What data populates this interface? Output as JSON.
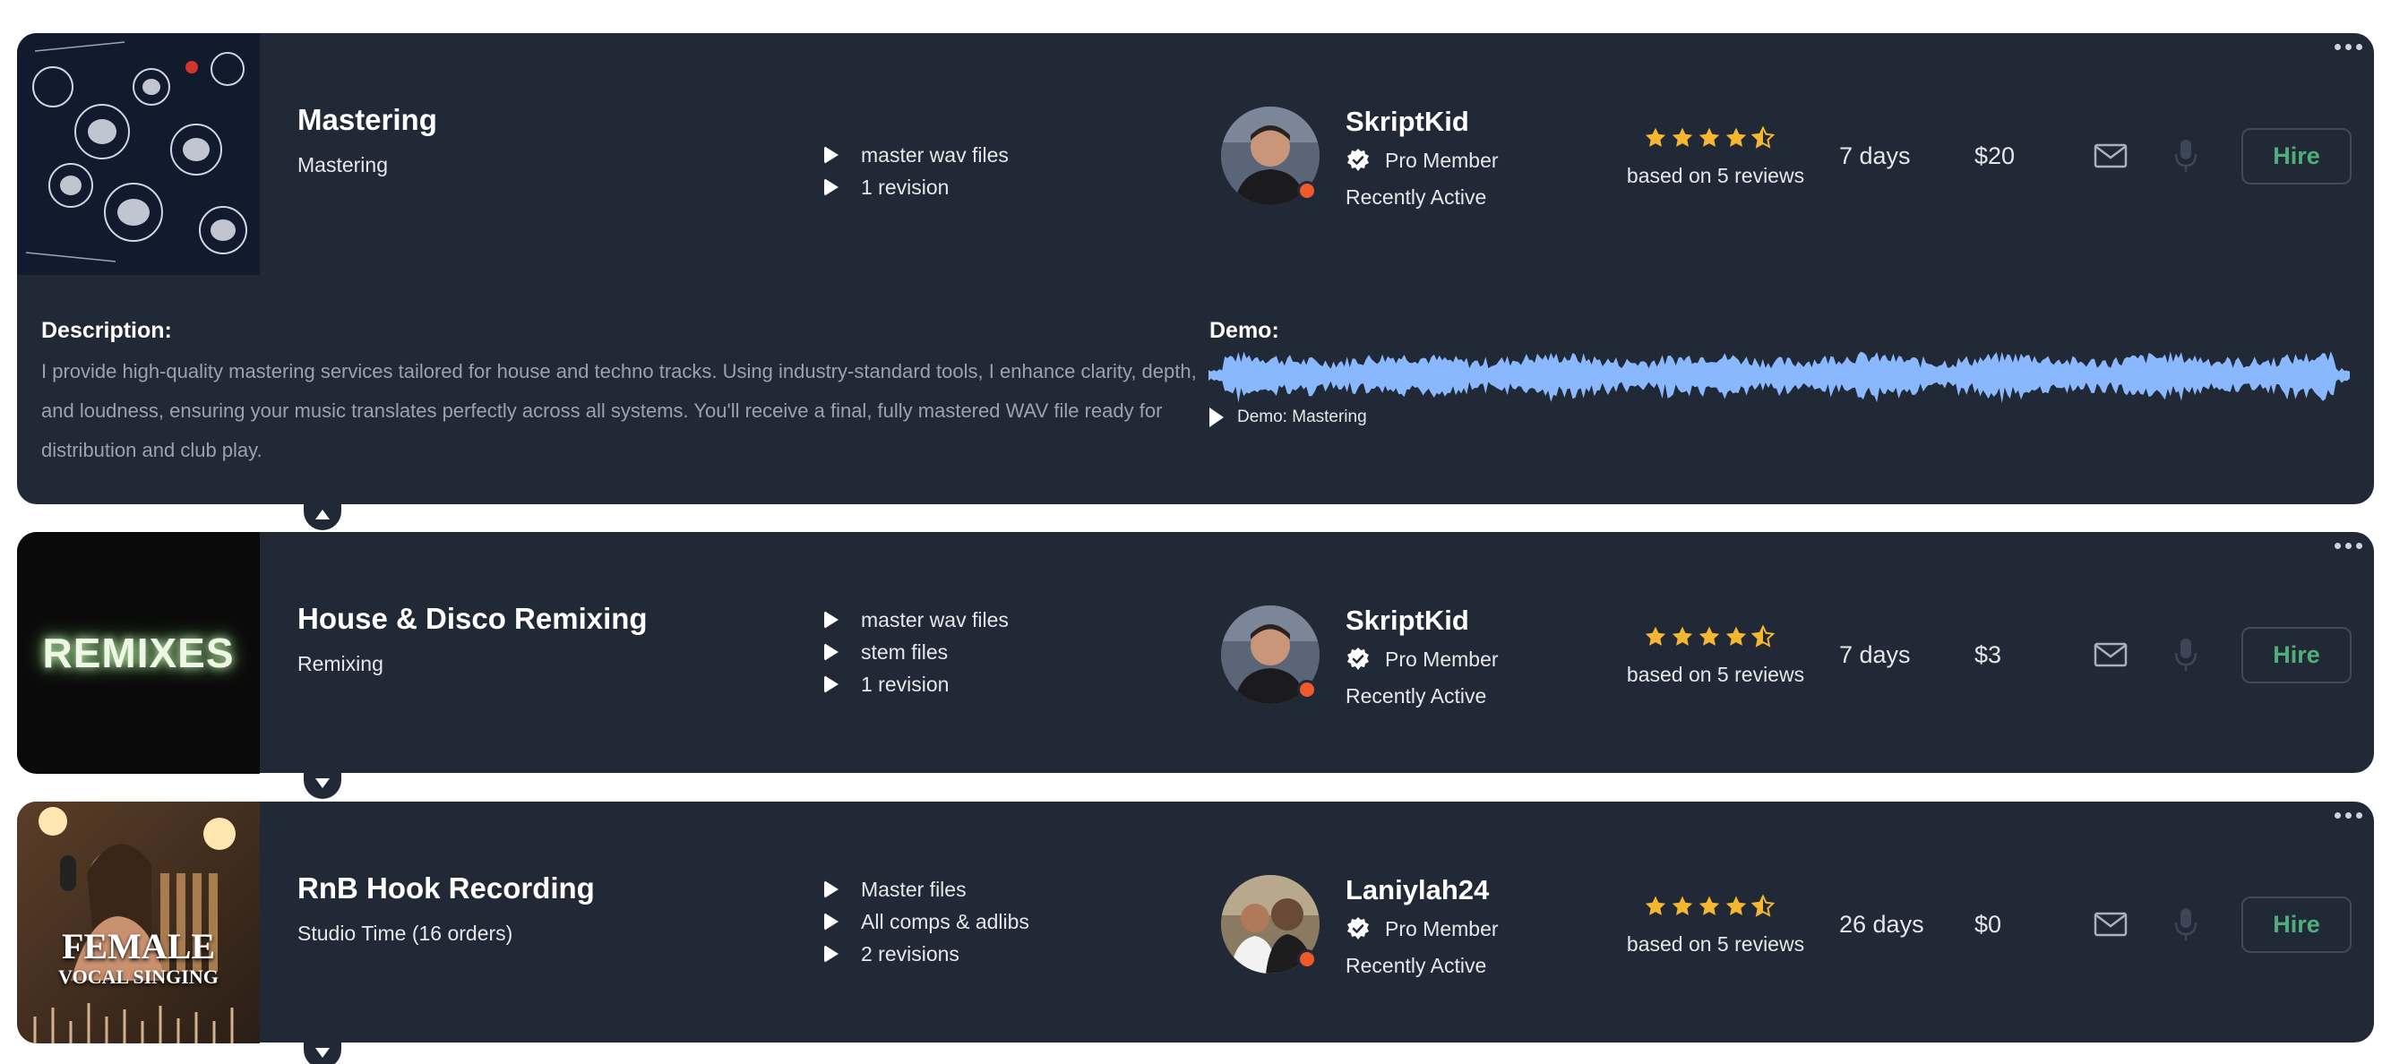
{
  "services": [
    {
      "title": "Mastering",
      "subtitle": "Mastering",
      "features": [
        "master wav files",
        "1 revision"
      ],
      "seller": {
        "name": "SkriptKid",
        "badge": "Pro Member",
        "status": "Recently Active"
      },
      "rating": {
        "stars": 4.5,
        "text": "based on 5 reviews"
      },
      "delivery": "7 days",
      "price": "$20",
      "hire_label": "Hire",
      "expanded": true,
      "description_label": "Description:",
      "description": "I provide high-quality mastering services tailored for house and techno tracks. Using industry-standard tools, I enhance clarity, depth, and loudness, ensuring your music translates perfectly across all systems. You'll receive a final, fully mastered WAV file ready for distribution and club play.",
      "demo_label": "Demo:",
      "demo_track": "Demo: Mastering"
    },
    {
      "title": "House & Disco Remixing",
      "subtitle": "Remixing",
      "thumb_text": "REMIXES",
      "features": [
        "master wav files",
        "stem files",
        "1 revision"
      ],
      "seller": {
        "name": "SkriptKid",
        "badge": "Pro Member",
        "status": "Recently Active"
      },
      "rating": {
        "stars": 4.5,
        "text": "based on 5 reviews"
      },
      "delivery": "7 days",
      "price": "$3",
      "hire_label": "Hire",
      "expanded": false
    },
    {
      "title": "RnB Hook Recording",
      "subtitle": "Studio Time (16 orders)",
      "thumb_text_1": "FEMALE",
      "thumb_text_2": "VOCAL SINGING",
      "features": [
        "Master files",
        "All comps & adlibs",
        "2 revisions"
      ],
      "seller": {
        "name": "Laniylah24",
        "badge": "Pro Member",
        "status": "Recently Active"
      },
      "rating": {
        "stars": 4.5,
        "text": "based on 5 reviews"
      },
      "delivery": "26 days",
      "price": "$0",
      "hire_label": "Hire",
      "expanded": false
    }
  ],
  "colors": {
    "card_bg": "#222936",
    "star": "#f5b731",
    "hire_text": "#4fae7a",
    "waveform": "#8ab8ff",
    "status_dot": "#f05a2a"
  },
  "icons": {
    "more": "more-dots-icon",
    "mail": "mail-icon",
    "mic": "microphone-icon",
    "verified": "verified-badge-icon",
    "star": "star-icon",
    "play": "play-icon"
  }
}
